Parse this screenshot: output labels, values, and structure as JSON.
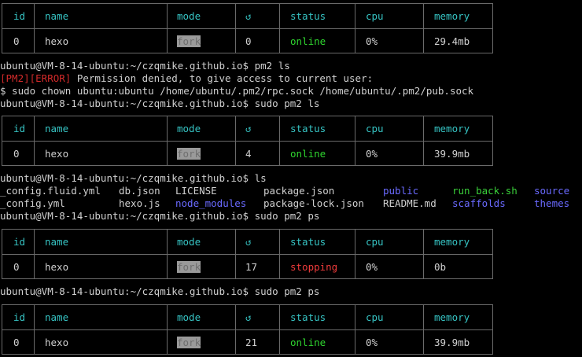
{
  "columns": {
    "id": "id",
    "name": "name",
    "mode": "mode",
    "restart_icon": "↺",
    "status": "status",
    "cpu": "cpu",
    "memory": "memory"
  },
  "tables": [
    {
      "id": "0",
      "name": "hexo",
      "mode": "fork",
      "restarts": "0",
      "status": "online",
      "cpu": "0%",
      "memory": "29.4mb"
    },
    {
      "id": "0",
      "name": "hexo",
      "mode": "fork",
      "restarts": "4",
      "status": "online",
      "cpu": "0%",
      "memory": "39.9mb"
    },
    {
      "id": "0",
      "name": "hexo",
      "mode": "fork",
      "restarts": "17",
      "status": "stopping",
      "cpu": "0%",
      "memory": "0b"
    },
    {
      "id": "0",
      "name": "hexo",
      "mode": "fork",
      "restarts": "21",
      "status": "online",
      "cpu": "0%",
      "memory": "39.9mb"
    }
  ],
  "prompt": "ubuntu@VM-8-14-ubuntu:~/czqmike.github.io$",
  "commands": {
    "c1": "pm2 ls",
    "c2": "sudo pm2 ls",
    "c3": "ls",
    "c4": "sudo pm2 ps",
    "c5": "sudo pm2 ps"
  },
  "error": {
    "tag": "[PM2][ERROR]",
    "message": " Permission denied, to give access to current user:",
    "fix": "$ sudo chown ubuntu:ubuntu /home/ubuntu/.pm2/rpc.sock /home/ubuntu/.pm2/pub.sock"
  },
  "ls_output": {
    "row1": [
      "_config.fluid.yml",
      "db.json",
      "LICENSE",
      "package.json",
      "public",
      "run_back.sh",
      "source"
    ],
    "row2": [
      "_config.yml",
      "hexo.js",
      "node_modules",
      "package-lock.json",
      "README.md",
      "scaffolds",
      "themes"
    ]
  },
  "colors": {
    "header": "#36c3c3",
    "online": "#2fd52f",
    "stopping": "#ef3b3b",
    "directory": "#6a6aff",
    "executable": "#3ad03a",
    "error_tag": "#d22a2a",
    "border": "#6a6a6a",
    "background": "#000000"
  }
}
